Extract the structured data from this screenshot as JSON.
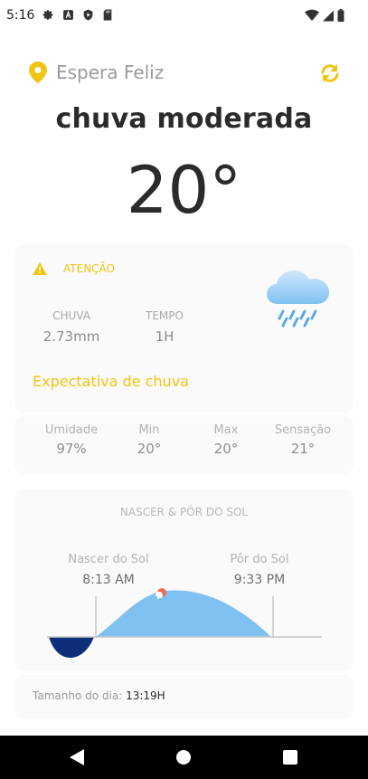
{
  "status": {
    "time": "5:16",
    "left_icons": [
      "gear-icon",
      "font-a-icon",
      "play-protect-icon",
      "sd-card-icon"
    ],
    "right_icons": [
      "wifi-icon",
      "signal-icon",
      "battery-icon"
    ]
  },
  "header": {
    "location": "Espera Feliz",
    "location_icon": "location-pin-icon",
    "refresh_icon": "refresh-icon",
    "accent": "#f1c40f"
  },
  "weather": {
    "condition": "chuva moderada",
    "temperature": "20°"
  },
  "alert": {
    "title": "ATENÇÃO",
    "rain_label": "CHUVA",
    "rain_value": "2.73mm",
    "time_label": "TEMPO",
    "time_value": "1H",
    "expectation": "Expectativa de chuva",
    "icon": "rain-cloud-icon"
  },
  "metrics": [
    {
      "label": "Umidade",
      "value": "97%"
    },
    {
      "label": "Min",
      "value": "20°"
    },
    {
      "label": "Max",
      "value": "20°"
    },
    {
      "label": "Sensação",
      "value": "21°"
    }
  ],
  "sun": {
    "title": "NASCER & PÔR DO SOL",
    "sunrise_label": "Nascer do Sol",
    "sunrise_time": "8:13 AM",
    "sunset_label": "Pôr do Sol",
    "sunset_time": "9:33 PM"
  },
  "daylength": {
    "label": "Tamanho do dia:",
    "value": "13:19H"
  },
  "navbar": {
    "icons": [
      "back-icon",
      "home-icon",
      "recents-icon"
    ]
  }
}
